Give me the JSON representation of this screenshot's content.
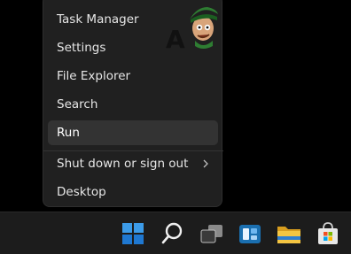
{
  "menu": {
    "items": [
      {
        "label": "Task Manager"
      },
      {
        "label": "Settings"
      },
      {
        "label": "File Explorer"
      },
      {
        "label": "Search"
      },
      {
        "label": "Run"
      },
      {
        "label": "Shut down or sign out"
      },
      {
        "label": "Desktop"
      }
    ],
    "highlighted_item": "Run"
  },
  "logo": {
    "text": "A"
  },
  "taskbar": {
    "icons": [
      "windows-start-icon",
      "search-icon",
      "task-view-icon",
      "widgets-icon",
      "file-explorer-icon",
      "microsoft-store-icon"
    ]
  },
  "colors": {
    "menu_bg": "#202020",
    "highlight_bg": "#333333",
    "taskbar_bg": "#1c1c1c",
    "start_blue": "#1e88e5",
    "folder_yellow": "#f4c542"
  }
}
